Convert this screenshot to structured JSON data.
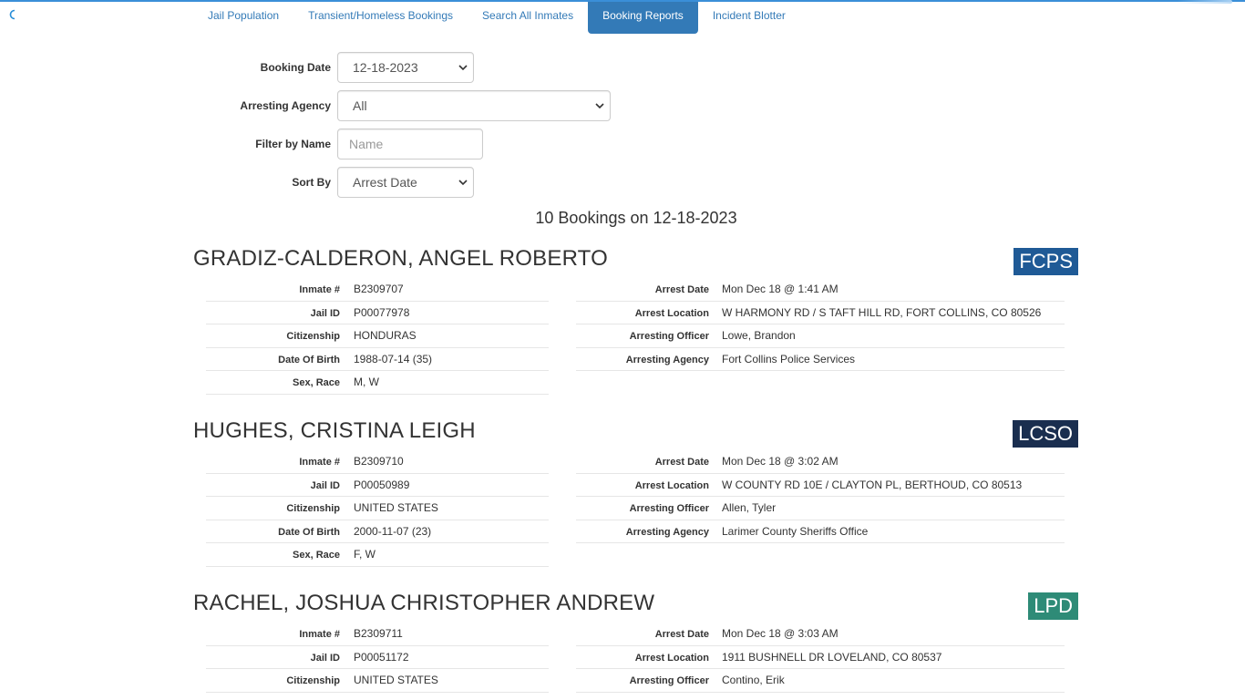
{
  "nav": {
    "tabs": [
      {
        "label": "Jail Population"
      },
      {
        "label": "Transient/Homeless Bookings"
      },
      {
        "label": "Search All Inmates"
      },
      {
        "label": "Booking Reports"
      },
      {
        "label": "Incident Blotter"
      }
    ],
    "active_tab": "Booking Reports"
  },
  "filters": {
    "booking_date": {
      "label": "Booking Date",
      "value": "12-18-2023"
    },
    "arresting_agency": {
      "label": "Arresting Agency",
      "value": "All"
    },
    "filter_by_name": {
      "label": "Filter by Name",
      "placeholder": "Name"
    },
    "sort_by": {
      "label": "Sort By",
      "value": "Arrest Date"
    }
  },
  "summary": "10 Bookings on 12-18-2023",
  "labels": {
    "inmate_no": "Inmate #",
    "jail_id": "Jail ID",
    "citizenship": "Citizenship",
    "dob": "Date Of Birth",
    "sex_race": "Sex, Race",
    "arrest_date": "Arrest Date",
    "arrest_location": "Arrest Location",
    "arresting_officer": "Arresting Officer",
    "arresting_agency": "Arresting Agency"
  },
  "bookings": [
    {
      "name": "GRADIZ-CALDERON, ANGEL ROBERTO",
      "agency_code": "FCPS",
      "agency_color": "#1f5a96",
      "inmate_no": "B2309707",
      "jail_id": "P00077978",
      "citizenship": "HONDURAS",
      "dob": "1988-07-14 (35)",
      "sex_race": "M, W",
      "arrest_date": "Mon Dec 18 @ 1:41 AM",
      "arrest_location": "W HARMONY RD / S TAFT HILL RD, FORT COLLINS, CO 80526",
      "arresting_officer": "Lowe, Brandon",
      "arresting_agency": "Fort Collins Police Services"
    },
    {
      "name": "HUGHES, CRISTINA LEIGH",
      "agency_code": "LCSO",
      "agency_color": "#1a2e4f",
      "inmate_no": "B2309710",
      "jail_id": "P00050989",
      "citizenship": "UNITED STATES",
      "dob": "2000-11-07 (23)",
      "sex_race": "F, W",
      "arrest_date": "Mon Dec 18 @ 3:02 AM",
      "arrest_location": "W COUNTY RD 10E / CLAYTON PL, BERTHOUD, CO 80513",
      "arresting_officer": "Allen, Tyler",
      "arresting_agency": "Larimer County Sheriffs Office"
    },
    {
      "name": "RACHEL, JOSHUA CHRISTOPHER ANDREW",
      "agency_code": "LPD",
      "agency_color": "#2e8b77",
      "inmate_no": "B2309711",
      "jail_id": "P00051172",
      "citizenship": "UNITED STATES",
      "arrest_date": "Mon Dec 18 @ 3:03 AM",
      "arrest_location": "1911 BUSHNELL DR LOVELAND, CO 80537",
      "arresting_officer": "Contino, Erik"
    }
  ]
}
